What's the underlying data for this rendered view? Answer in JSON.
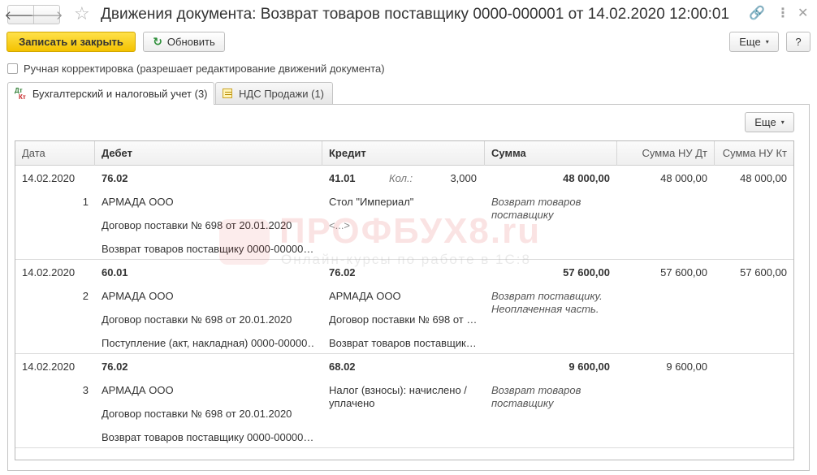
{
  "window": {
    "title": "Движения документа: Возврат товаров поставщику 0000-000001 от 14.02.2020 12:00:01",
    "back_glyph": "🡐",
    "forward_glyph": "🡒",
    "star_glyph": "☆",
    "link_glyph": "🔗",
    "more_glyph": "⋮",
    "close_glyph": "✕"
  },
  "toolbar": {
    "save_close_label": "Записать и закрыть",
    "refresh_label": "Обновить",
    "refresh_glyph": "↻",
    "more_label": "Еще",
    "more_caret": "▾",
    "help_label": "?"
  },
  "manual_correction": {
    "label": "Ручная корректировка (разрешает редактирование движений документа)",
    "checked": false
  },
  "tabs": [
    {
      "label": "Бухгалтерский и налоговый учет (3)",
      "icon": "dt-kt-icon",
      "active": true,
      "icon_text_top": "Дт",
      "icon_text_bottom": "Кт"
    },
    {
      "label": "НДС Продажи (1)",
      "icon": "nds-icon",
      "active": false
    }
  ],
  "grid_toolbar": {
    "more_label": "Еще",
    "more_caret": "▾"
  },
  "grid": {
    "columns": {
      "date": "Дата",
      "debit": "Дебет",
      "credit": "Кредит",
      "sum": "Сумма",
      "sum_nu_dt": "Сумма НУ Дт",
      "sum_nu_kt": "Сумма НУ Кт"
    },
    "rows": [
      {
        "date": "14.02.2020",
        "num": "1",
        "debit_account": "76.02",
        "debit_sub1": "АРМАДА ООО",
        "debit_sub2": "Договор поставки № 698 от 20.01.2020",
        "debit_sub3": "Возврат товаров поставщику 0000-00000…",
        "credit_account": "41.01",
        "qty_label": "Кол.:",
        "qty_value": "3,000",
        "credit_sub1": "Стол \"Империал\"",
        "credit_sub2": "<...>",
        "credit_sub3": "",
        "sum": "48 000,00",
        "comment": "Возврат товаров поставщику",
        "sum_nu_dt": "48 000,00",
        "sum_nu_kt": "48 000,00"
      },
      {
        "date": "14.02.2020",
        "num": "2",
        "debit_account": "60.01",
        "debit_sub1": "АРМАДА ООО",
        "debit_sub2": "Договор поставки № 698 от 20.01.2020",
        "debit_sub3": "Поступление (акт, накладная) 0000-00000…",
        "credit_account": "76.02",
        "qty_label": "",
        "qty_value": "",
        "credit_sub1": "АРМАДА ООО",
        "credit_sub2": "Договор поставки № 698 от …",
        "credit_sub3": "Возврат товаров поставщик…",
        "sum": "57 600,00",
        "comment": "Возврат поставщику. Неоплаченная часть.",
        "sum_nu_dt": "57 600,00",
        "sum_nu_kt": "57 600,00"
      },
      {
        "date": "14.02.2020",
        "num": "3",
        "debit_account": "76.02",
        "debit_sub1": "АРМАДА ООО",
        "debit_sub2": "Договор поставки № 698 от 20.01.2020",
        "debit_sub3": "Возврат товаров поставщику 0000-00000…",
        "credit_account": "68.02",
        "qty_label": "",
        "qty_value": "",
        "credit_sub1": "Налог (взносы): начислено / уплачено",
        "credit_sub2": "",
        "credit_sub3": "",
        "sum": "9 600,00",
        "comment": "Возврат товаров поставщику",
        "sum_nu_dt": "9 600,00",
        "sum_nu_kt": ""
      }
    ]
  },
  "watermark": {
    "brand": "ПРОФБУХ8.ru",
    "tagline": "Онлайн-курсы по работе в 1С:8"
  },
  "colors": {
    "primary_button": "#f4c200",
    "refresh_icon": "#2e8f3a",
    "watermark": "#d72828"
  }
}
